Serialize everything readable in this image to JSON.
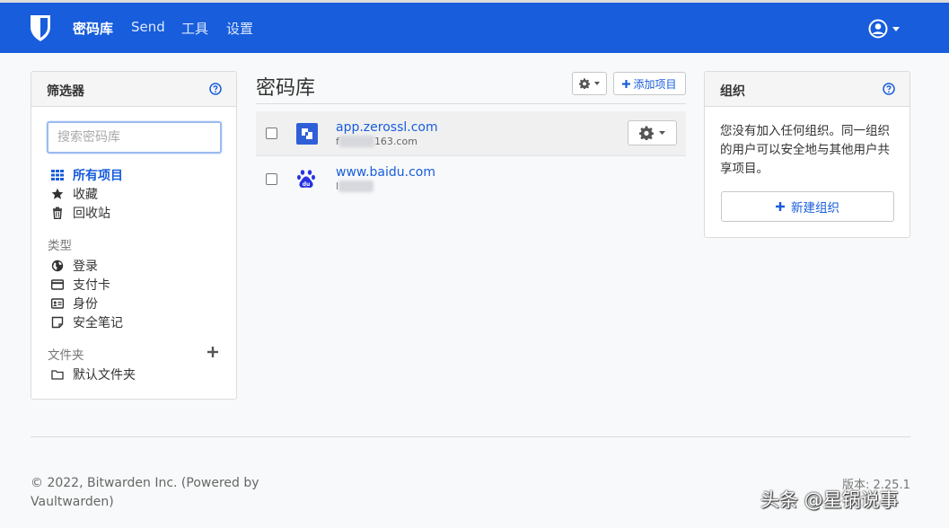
{
  "nav": {
    "items": [
      "密码库",
      "Send",
      "工具",
      "设置"
    ],
    "active_index": 0
  },
  "filters": {
    "title": "筛选器",
    "search_placeholder": "搜索密码库",
    "all_items": "所有项目",
    "favorites": "收藏",
    "trash": "回收站",
    "types_label": "类型",
    "types": [
      "登录",
      "支付卡",
      "身份",
      "安全笔记"
    ],
    "folders_label": "文件夹",
    "default_folder": "默认文件夹"
  },
  "vault": {
    "title": "密码库",
    "add_item_label": "添加项目",
    "items": [
      {
        "name": "app.zerossl.com",
        "sub_start": "f",
        "sub_hidden": "xxxxxx",
        "sub_end": "163.com"
      },
      {
        "name": "www.baidu.com",
        "sub_start": "l",
        "sub_hidden": "xxxxxx",
        "sub_end": ""
      }
    ]
  },
  "org": {
    "title": "组织",
    "text": "您没有加入任何组织。同一组织的用户可以安全地与其他用户共享项目。",
    "new_org_label": "新建组织"
  },
  "footer": {
    "copyright": "© 2022, Bitwarden Inc. (Powered by Vaultwarden)",
    "version": "版本: 2.25.1"
  },
  "watermark": "头条 @星锅说事",
  "colors": {
    "brand": "#175ddc",
    "background": "#f8f9fa",
    "panel_border": "#dcdcdc"
  }
}
